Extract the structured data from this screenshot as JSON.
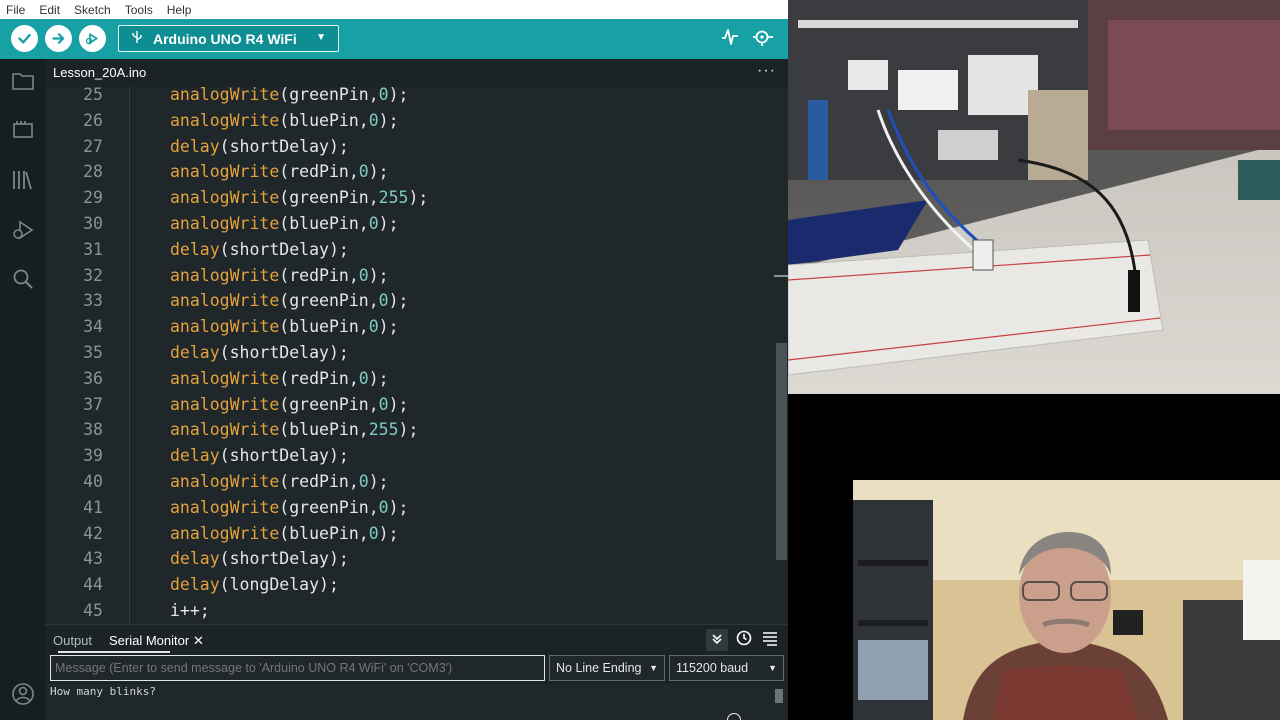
{
  "menu": [
    "File",
    "Edit",
    "Sketch",
    "Tools",
    "Help"
  ],
  "toolbar": {
    "verify_icon": "check-icon",
    "upload_icon": "arrow-right-icon",
    "debug_icon": "debug-icon",
    "board": "Arduino UNO R4 WiFi",
    "board_icon": "usb-icon",
    "serial_plotter_icon": "plotter-icon",
    "serial_monitor_icon": "serial-monitor-icon"
  },
  "sidebar": [
    "folder-icon",
    "board-icon",
    "library-icon",
    "debug-icon",
    "search-icon",
    "account-icon"
  ],
  "tab": {
    "filename": "Lesson_20A.ino",
    "more": "···"
  },
  "code_lines": [
    {
      "n": "25",
      "fn": "analogWrite",
      "arg": "greenPin",
      "val": "0",
      "end": ");"
    },
    {
      "n": "26",
      "fn": "analogWrite",
      "arg": "bluePin",
      "val": "0",
      "end": ");"
    },
    {
      "n": "27",
      "fn": "delay",
      "arg": "shortDelay",
      "val": "",
      "end": ");"
    },
    {
      "n": "28",
      "fn": "analogWrite",
      "arg": "redPin",
      "val": "0",
      "end": ");"
    },
    {
      "n": "29",
      "fn": "analogWrite",
      "arg": "greenPin",
      "val": "255",
      "end": ");"
    },
    {
      "n": "30",
      "fn": "analogWrite",
      "arg": "bluePin",
      "val": "0",
      "end": ");"
    },
    {
      "n": "31",
      "fn": "delay",
      "arg": "shortDelay",
      "val": "",
      "end": ");"
    },
    {
      "n": "32",
      "fn": "analogWrite",
      "arg": "redPin",
      "val": "0",
      "end": ");"
    },
    {
      "n": "33",
      "fn": "analogWrite",
      "arg": "greenPin",
      "val": "0",
      "end": ");"
    },
    {
      "n": "34",
      "fn": "analogWrite",
      "arg": "bluePin",
      "val": "0",
      "end": ");"
    },
    {
      "n": "35",
      "fn": "delay",
      "arg": "shortDelay",
      "val": "",
      "end": ");"
    },
    {
      "n": "36",
      "fn": "analogWrite",
      "arg": "redPin",
      "val": "0",
      "end": ");"
    },
    {
      "n": "37",
      "fn": "analogWrite",
      "arg": "greenPin",
      "val": "0",
      "end": ");"
    },
    {
      "n": "38",
      "fn": "analogWrite",
      "arg": "bluePin",
      "val": "255",
      "end": ");"
    },
    {
      "n": "39",
      "fn": "delay",
      "arg": "shortDelay",
      "val": "",
      "end": ");"
    },
    {
      "n": "40",
      "fn": "analogWrite",
      "arg": "redPin",
      "val": "0",
      "end": ");"
    },
    {
      "n": "41",
      "fn": "analogWrite",
      "arg": "greenPin",
      "val": "0",
      "end": ");"
    },
    {
      "n": "42",
      "fn": "analogWrite",
      "arg": "bluePin",
      "val": "0",
      "end": ");"
    },
    {
      "n": "43",
      "fn": "delay",
      "arg": "shortDelay",
      "val": "",
      "end": ");"
    },
    {
      "n": "44",
      "fn": "delay",
      "arg": "longDelay",
      "val": "",
      "end": ");"
    },
    {
      "n": "45",
      "fn": "",
      "arg": "i++;",
      "val": "",
      "end": ""
    }
  ],
  "panel": {
    "tab_output": "Output",
    "tab_serial": "Serial Monitor",
    "close": "✕",
    "message_placeholder": "Message (Enter to send message to 'Arduino UNO R4 WiFi' on 'COM3')",
    "line_ending": "No Line Ending",
    "baud": "115200 baud",
    "output_text": "How many blinks?"
  },
  "colors": {
    "toolbar": "#17a1a5",
    "editor_bg": "#1f272a",
    "function": "#e4a23c",
    "number": "#7fcbc4"
  }
}
